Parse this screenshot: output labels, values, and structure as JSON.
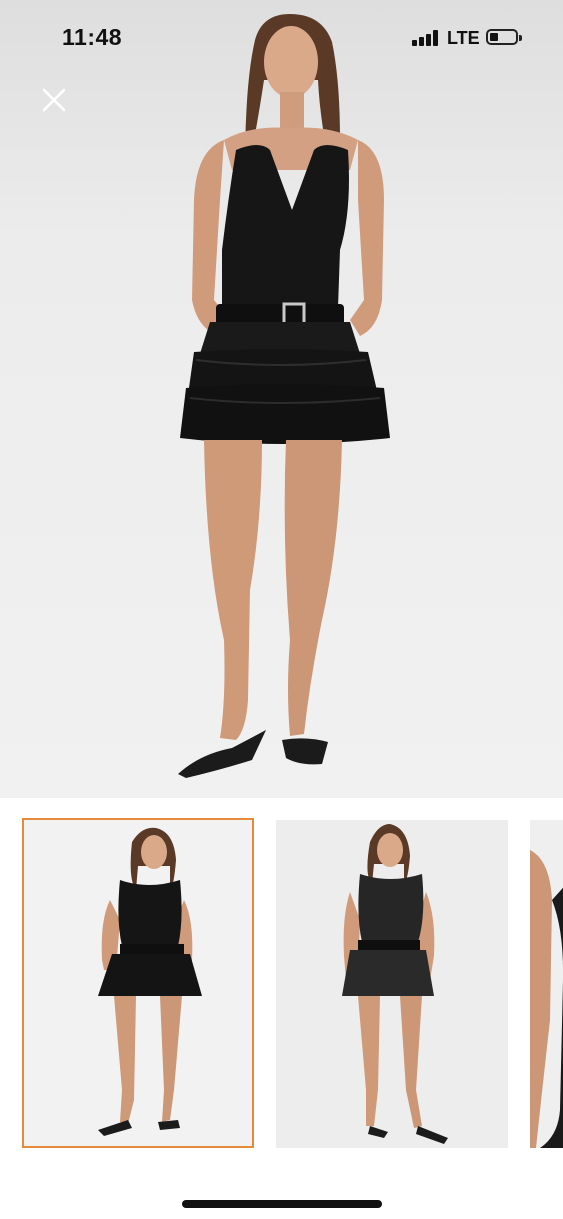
{
  "status_bar": {
    "time": "11:48",
    "network": "LTE",
    "battery_icon": "battery-low-icon",
    "signal_icon": "cellular-signal-icon"
  },
  "viewer": {
    "close_icon": "close-icon",
    "selected_thumbnail": 1,
    "thumbnail_count": 3
  },
  "colors": {
    "selected_border": "#e58a3a",
    "background": "#ffffff",
    "garment": "#151515"
  }
}
